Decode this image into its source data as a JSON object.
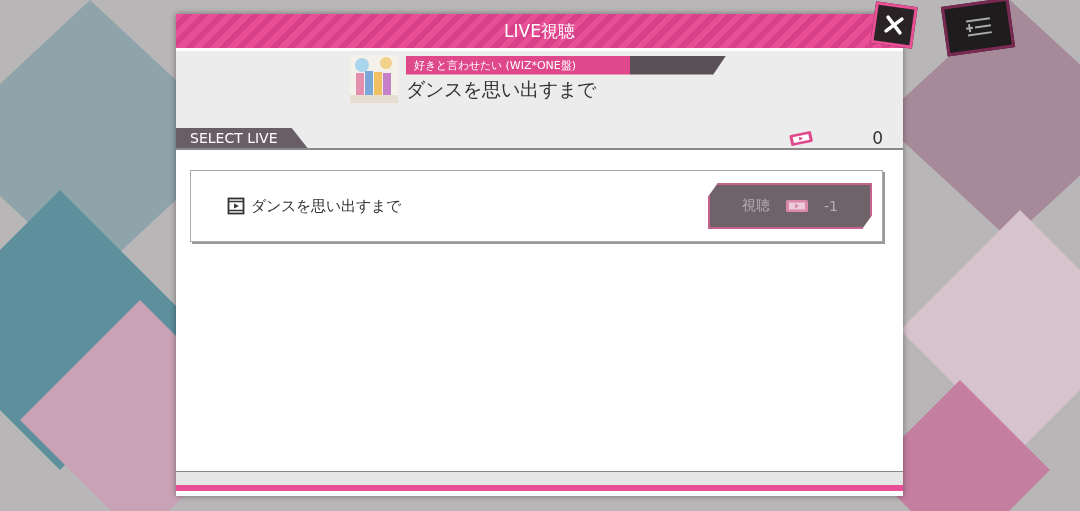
{
  "dialog": {
    "title": "LIVE視聴"
  },
  "song": {
    "album": "好きと言わせたい (WIZ*ONE盤)",
    "title": "ダンスを思い出すまで"
  },
  "section": {
    "label": "SELECT LIVE",
    "tickets": "0"
  },
  "lives": [
    {
      "title": "ダンスを思い出すまで",
      "button": {
        "label": "視聴",
        "cost": "-1",
        "disabled": true
      }
    }
  ]
}
